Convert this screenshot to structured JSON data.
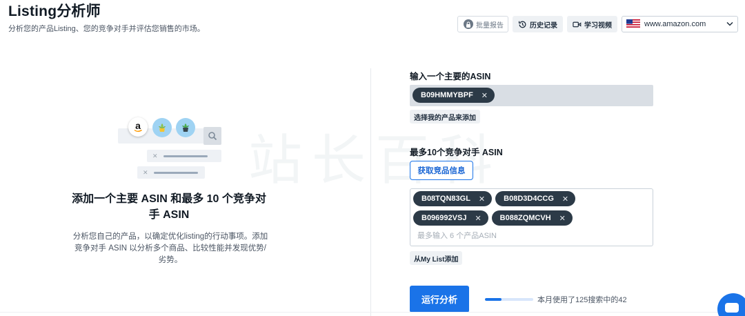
{
  "header": {
    "title": "Listing分析师",
    "subtitle": "分析您的产品Listing、您的竞争对手并评估您销售的市场。"
  },
  "toolbar": {
    "bulk_report": "批量报告",
    "history": "历史记录",
    "videos": "学习视频",
    "marketplace": "www.amazon.com",
    "icons": {
      "bulk_report": "lock-icon",
      "history": "history-icon",
      "videos": "video-icon",
      "marketplace_flag": "us-flag-icon",
      "dropdown": "chevron-down-icon"
    }
  },
  "illustration": {
    "amazon_letter": "a"
  },
  "empty_state": {
    "heading": "添加一个主要 ASIN 和最多 10 个竞争对手 ASIN",
    "description": "分析您自己的产品，以确定优化listing的行动事项。添加竞争对手 ASIN 以分析多个商品、比较性能并发现优势/劣势。"
  },
  "watermark": "站长百科",
  "main_asin": {
    "label": "输入一个主要的ASIN",
    "chip": "B09HMMYBPF",
    "select_button": "选择我的产品来添加"
  },
  "competitors": {
    "label": "最多10个竞争对手 ASIN",
    "fetch_button": "获取竞品信息",
    "chips_row1": [
      "B08TQN83GL",
      "B08D3D4CCG"
    ],
    "chips_row2": [
      "B096992VSJ",
      "B088ZQMCVH"
    ],
    "placeholder": "最多输入 6 个产品ASIN",
    "mylist_button": "从My List添加"
  },
  "run": {
    "button": "运行分析",
    "usage_text": "本月使用了125搜索中的42",
    "usage_used": 42,
    "usage_total": 125
  },
  "colors": {
    "accent": "#1a73e8",
    "chip": "#2c3a47"
  }
}
